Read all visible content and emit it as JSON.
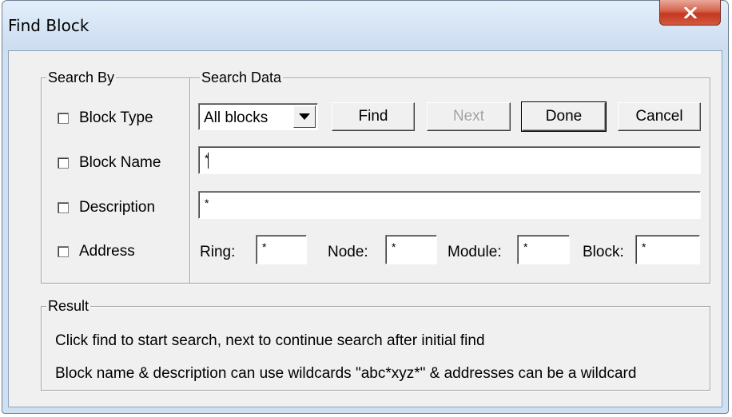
{
  "window": {
    "title": "Find Block"
  },
  "search_by": {
    "label": "Search By",
    "options": [
      {
        "label": "Block Type",
        "checked": false
      },
      {
        "label": "Block Name",
        "checked": false
      },
      {
        "label": "Description",
        "checked": false
      },
      {
        "label": "Address",
        "checked": false
      }
    ]
  },
  "search_data": {
    "label": "Search Data",
    "block_type_select": {
      "value": "All blocks"
    },
    "buttons": {
      "find": "Find",
      "next": "Next",
      "done": "Done",
      "cancel": "Cancel"
    },
    "block_name_value": "*",
    "description_value": "*",
    "address": {
      "ring_label": "Ring:",
      "ring_value": "*",
      "node_label": "Node:",
      "node_value": "*",
      "module_label": "Module:",
      "module_value": "*",
      "block_label": "Block:",
      "block_value": "*"
    }
  },
  "result": {
    "label": "Result",
    "line1": "Click find to start search, next to continue search after initial find",
    "line2": "Block name & description can use wildcards \"abc*xyz*\" & addresses can be a wildcard"
  },
  "icons": {
    "close": "close-x-icon",
    "dropdown": "triangle-down-icon"
  }
}
